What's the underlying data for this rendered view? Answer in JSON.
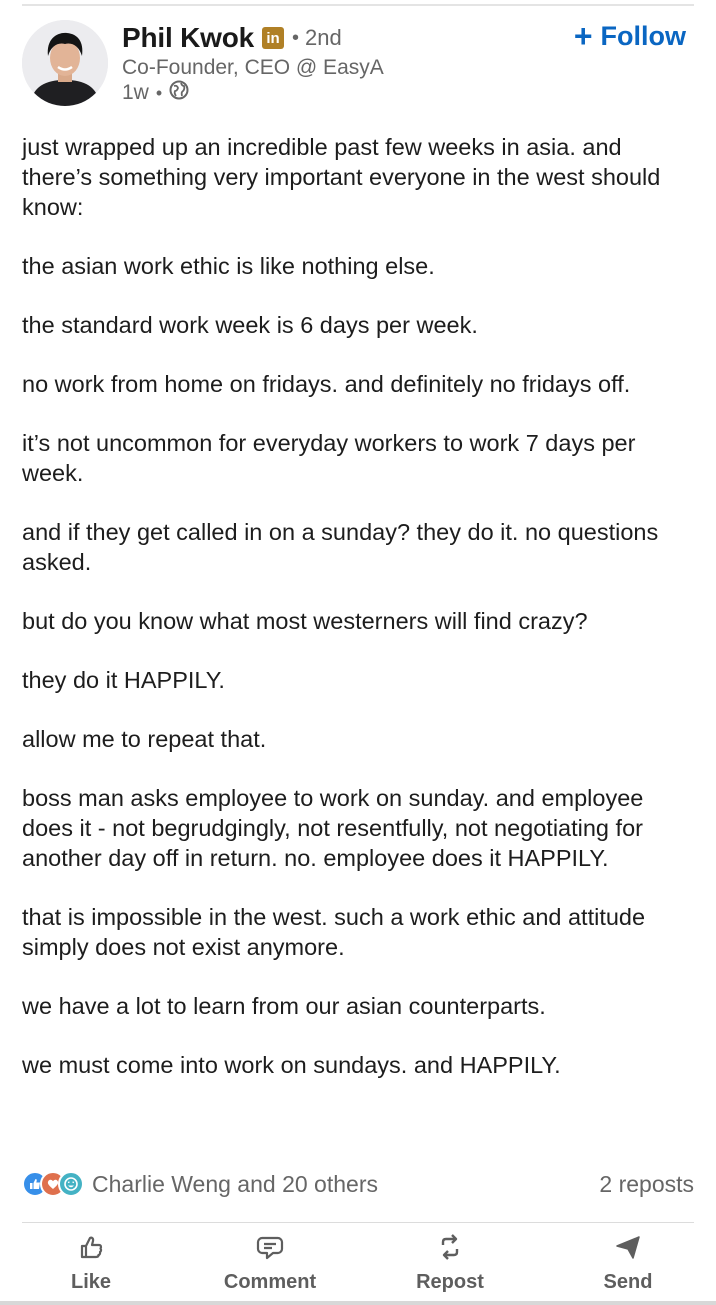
{
  "post": {
    "author": {
      "name": "Phil Kwok",
      "badge_text": "in",
      "connection_degree": "2nd",
      "headline": "Co-Founder, CEO @ EasyA",
      "time_ago": "1w",
      "visibility_icon": "globe-icon"
    },
    "follow_button": {
      "label": "Follow",
      "icon": "plus-icon"
    },
    "paragraphs": [
      "just wrapped up an incredible past few weeks in asia. and there’s something very important everyone in the west should know:",
      "the asian work ethic is like nothing else.",
      "the standard work week is 6 days per week.",
      "no work from home on fridays. and definitely no fridays off.",
      "it’s not uncommon for everyday workers to work 7 days per week.",
      "and if they get called in on a sunday? they do it. no questions asked.",
      "but do you know what most westerners will find crazy?",
      "they do it HAPPILY.",
      "allow me to repeat that.",
      "boss man asks employee to work on sunday. and employee does it - not begrudgingly, not resentfully, not negotiating for another day off in return. no. employee does it HAPPILY.",
      "that is impossible in the west. such a work ethic and attitude simply does not exist anymore.",
      "we have a lot to learn from our asian counterparts.",
      "we must come into work on sundays. and HAPPILY."
    ],
    "social": {
      "reactions": [
        "like-reaction-icon",
        "love-reaction-icon",
        "funny-reaction-icon"
      ],
      "reactors_text": "Charlie Weng and 20 others",
      "reposts_text": "2 reposts"
    },
    "actions": [
      {
        "label": "Like",
        "icon": "thumbs-up-icon"
      },
      {
        "label": "Comment",
        "icon": "comment-bubble-icon"
      },
      {
        "label": "Repost",
        "icon": "repost-arrows-icon"
      },
      {
        "label": "Send",
        "icon": "paper-plane-icon"
      }
    ]
  },
  "colors": {
    "link_blue": "#0a66c2",
    "text": "#1d1d1d",
    "secondary_text": "#666666",
    "badge_gold": "#b08026"
  }
}
